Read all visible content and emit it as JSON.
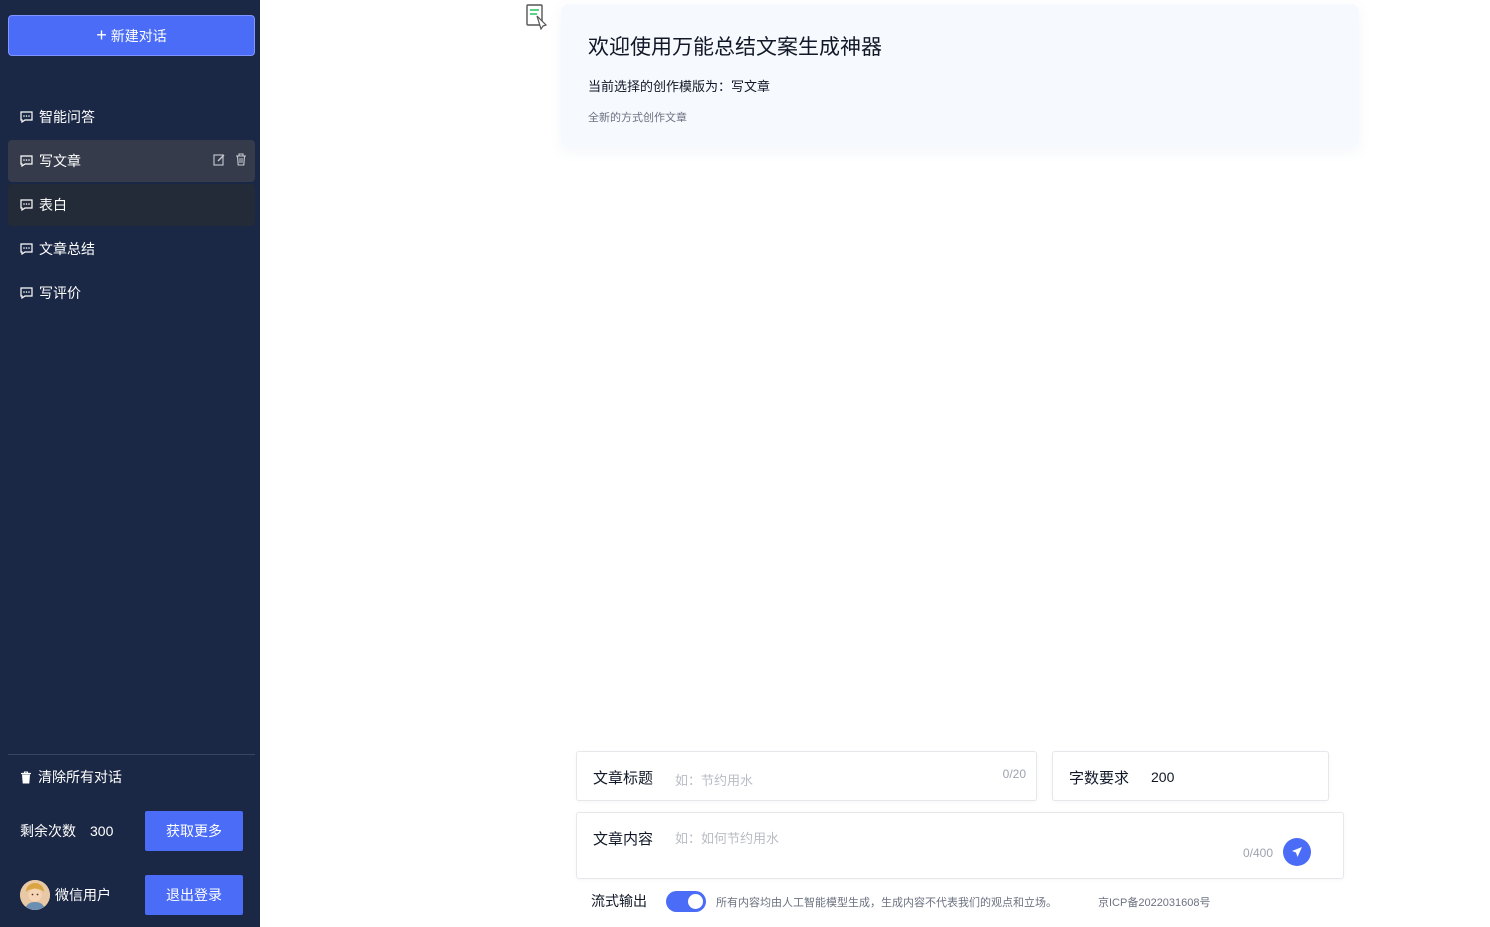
{
  "sidebar": {
    "new_chat_label": "新建对话",
    "items": [
      {
        "label": "智能问答"
      },
      {
        "label": "写文章"
      },
      {
        "label": "表白"
      },
      {
        "label": "文章总结"
      },
      {
        "label": "写评价"
      }
    ],
    "clear_all_label": "清除所有对话",
    "remaining_label": "剩余次数",
    "remaining_count": "300",
    "get_more_label": "获取更多",
    "user_name": "微信用户",
    "logout_label": "退出登录"
  },
  "welcome": {
    "title": "欢迎使用万能总结文案生成神器",
    "subtitle": "当前选择的创作模版为：写文章",
    "description": "全新的方式创作文章"
  },
  "form": {
    "title_label": "文章标题",
    "title_placeholder": "如：节约用水",
    "title_counter": "0/20",
    "words_label": "字数要求",
    "words_value": "200",
    "content_label": "文章内容",
    "content_placeholder": "如：如何节约用水",
    "content_counter": "0/400",
    "stream_label": "流式输出",
    "stream_enabled": true,
    "disclaimer": "所有内容均由人工智能模型生成，生成内容不代表我们的观点和立场。",
    "icp": "京ICP备2022031608号"
  },
  "colors": {
    "sidebar_bg": "#1b2845",
    "accent": "#4a6cf7",
    "card_bg": "#f6f9fd"
  }
}
